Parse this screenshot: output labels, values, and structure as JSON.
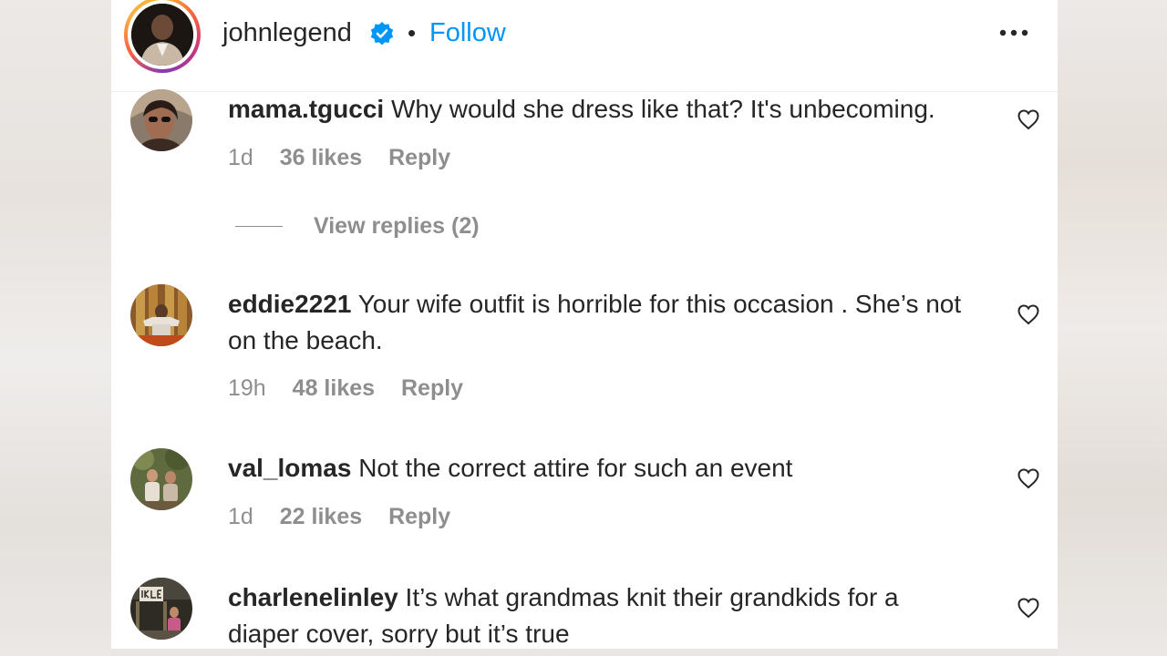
{
  "post_header": {
    "username": "johnlegend",
    "separator": "•",
    "follow_label": "Follow",
    "more_icon": "more-options-icon",
    "verified_icon": "verified-badge-icon"
  },
  "colors": {
    "accent": "#0095f6",
    "text": "#262626",
    "muted": "#8e8e8e",
    "verified": "#0095f6"
  },
  "comments": [
    {
      "username": "mama.tgucci",
      "text": "Why would she dress like that? It's unbecoming.",
      "time": "1d",
      "likes": "36 likes",
      "reply_label": "Reply",
      "view_replies": "View replies (2)"
    },
    {
      "username": "eddie2221",
      "text": "Your wife outfit is horrible for this occasion . She’s not on the beach.",
      "time": "19h",
      "likes": "48 likes",
      "reply_label": "Reply"
    },
    {
      "username": "val_lomas",
      "text": "Not the correct attire for such an event",
      "time": "1d",
      "likes": "22 likes",
      "reply_label": "Reply"
    },
    {
      "username": "charlenelinley",
      "text": "It’s what grandmas knit their grandkids for a diaper cover, sorry but it’s true"
    }
  ]
}
